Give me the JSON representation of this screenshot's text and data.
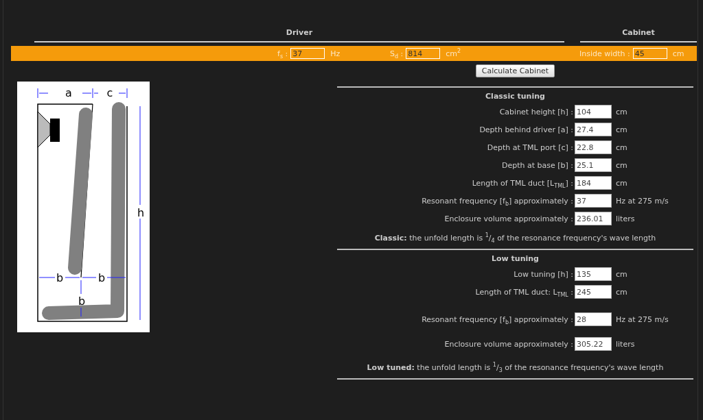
{
  "header": {
    "columns": [
      {
        "title": "Driver"
      },
      {
        "title": "Cabinet"
      }
    ]
  },
  "params": [
    {
      "label": "f$_{s}$ :",
      "value": "37",
      "unit": "Hz"
    },
    {
      "label": "S$_{d}$ :",
      "value": "814",
      "unit": "cm$^{2}$"
    },
    {
      "label": "Inside width :",
      "value": "45",
      "unit": "cm"
    }
  ],
  "diagram": {
    "labels": {
      "a": "a",
      "c": "c",
      "h": "h",
      "b_left": "b",
      "b_right": "b",
      "b_vertical": "b"
    }
  },
  "calculate_button": "Calculate Cabinet",
  "sections": [
    {
      "title": "Classic tuning",
      "rows": [
        {
          "label": "Cabinet height [h] :",
          "value": "104",
          "unit": "cm"
        },
        {
          "label": "Depth behind driver [a] :",
          "value": "27.4",
          "unit": "cm"
        },
        {
          "label": "Depth at TML port [c] :",
          "value": "22.8",
          "unit": "cm"
        },
        {
          "label": "Depth at base [b] :",
          "value": "25.1",
          "unit": "cm"
        },
        {
          "label": "Length of TML duct [L$_{TML}$] :",
          "value": "184",
          "unit": "cm"
        },
        {
          "label": "Resonant frequency [f$_{b}$] approximately :",
          "value": "37",
          "unit": "Hz at 275 m/s"
        },
        {
          "label": "Enclosure volume approximately :",
          "value": "236.01",
          "unit": "liters"
        }
      ],
      "note": "**Classic:** the unfold length is $^{1}$/$_{4}$ of the resonance frequency's wave length"
    },
    {
      "title": "Low tuning",
      "rows": [
        {
          "label": "Low tuning [h] :",
          "value": "135",
          "unit": "cm"
        },
        {
          "label": "Length of TML duct: L$_{TML}$ :",
          "value": "245",
          "unit": "cm"
        },
        {
          "label": "Resonant frequency [f$_{b}$] approximately :",
          "value": "28",
          "unit": "Hz at 275 m/s"
        },
        {
          "label": "Enclosure volume approximately :",
          "value": "305.22",
          "unit": "liters"
        }
      ],
      "note": "**Low tuned:** the unfold length is $^{1}$/$_{3}$ of the resonance frequency's wave length"
    }
  ]
}
